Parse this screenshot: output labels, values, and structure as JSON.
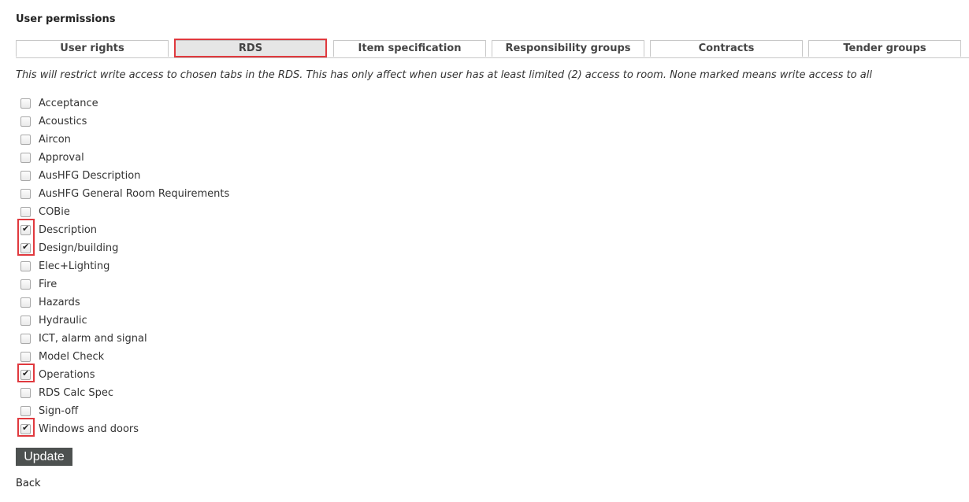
{
  "page": {
    "title": "User permissions"
  },
  "tabs": [
    {
      "label": "User rights",
      "active": false
    },
    {
      "label": "RDS",
      "active": true
    },
    {
      "label": "Item specification",
      "active": false
    },
    {
      "label": "Responsibility groups",
      "active": false
    },
    {
      "label": "Contracts",
      "active": false
    },
    {
      "label": "Tender groups",
      "active": false
    }
  ],
  "description": "This will restrict write access to chosen tabs in the RDS. This has only affect when user has at least limited (2) access to room. None marked means write access to all",
  "permissions": [
    {
      "label": "Acceptance",
      "checked": false
    },
    {
      "label": "Acoustics",
      "checked": false
    },
    {
      "label": "Aircon",
      "checked": false
    },
    {
      "label": "Approval",
      "checked": false
    },
    {
      "label": "AusHFG Description",
      "checked": false
    },
    {
      "label": "AusHFG General Room Requirements",
      "checked": false
    },
    {
      "label": "COBie",
      "checked": false
    },
    {
      "label": "Description",
      "checked": true
    },
    {
      "label": "Design/building",
      "checked": true
    },
    {
      "label": "Elec+Lighting",
      "checked": false
    },
    {
      "label": "Fire",
      "checked": false
    },
    {
      "label": "Hazards",
      "checked": false
    },
    {
      "label": "Hydraulic",
      "checked": false
    },
    {
      "label": "ICT, alarm and signal",
      "checked": false
    },
    {
      "label": "Model Check",
      "checked": false
    },
    {
      "label": "Operations",
      "checked": true
    },
    {
      "label": "RDS Calc Spec",
      "checked": false
    },
    {
      "label": "Sign-off",
      "checked": false
    },
    {
      "label": "Windows and doors",
      "checked": true
    }
  ],
  "actions": {
    "update_label": "Update",
    "back_label": "Back"
  },
  "colors": {
    "highlight": "#e0393e",
    "button_bg": "#4d5150",
    "active_tab_bg": "#e6e6e6"
  }
}
